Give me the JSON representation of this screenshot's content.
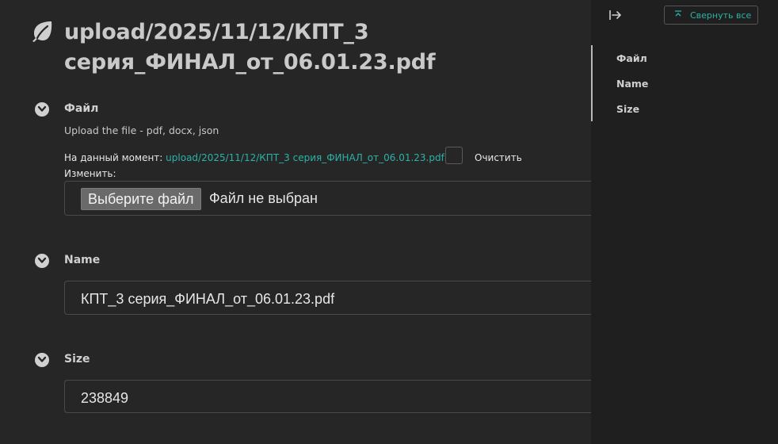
{
  "page": {
    "title": "upload/2025/11/12/КПТ_3 серия_ФИНАЛ_от_06.01.23.pdf",
    "icon": "leaf-icon"
  },
  "sections": {
    "file": {
      "label": "Файл",
      "help": "Upload the file - pdf, docx, json",
      "current_prefix": "На данный момент:",
      "current_link": "upload/2025/11/12/КПТ_3 серия_ФИНАЛ_от_06.01.23.pdf",
      "clear_label": "Очистить",
      "change_label": "Изменить:",
      "choose_button": "Выберите файл",
      "no_file": "Файл не выбран"
    },
    "name": {
      "label": "Name",
      "value": "КПТ_3 серия_ФИНАЛ_от_06.01.23.pdf"
    },
    "size": {
      "label": "Size",
      "value": "238849"
    }
  },
  "side_panel": {
    "collapse_all": "Свернуть все",
    "toc": [
      "Файл",
      "Name",
      "Size"
    ]
  },
  "colors": {
    "background": "#262626",
    "panel": "#1f1f1f",
    "accent": "#2bb3a6"
  }
}
